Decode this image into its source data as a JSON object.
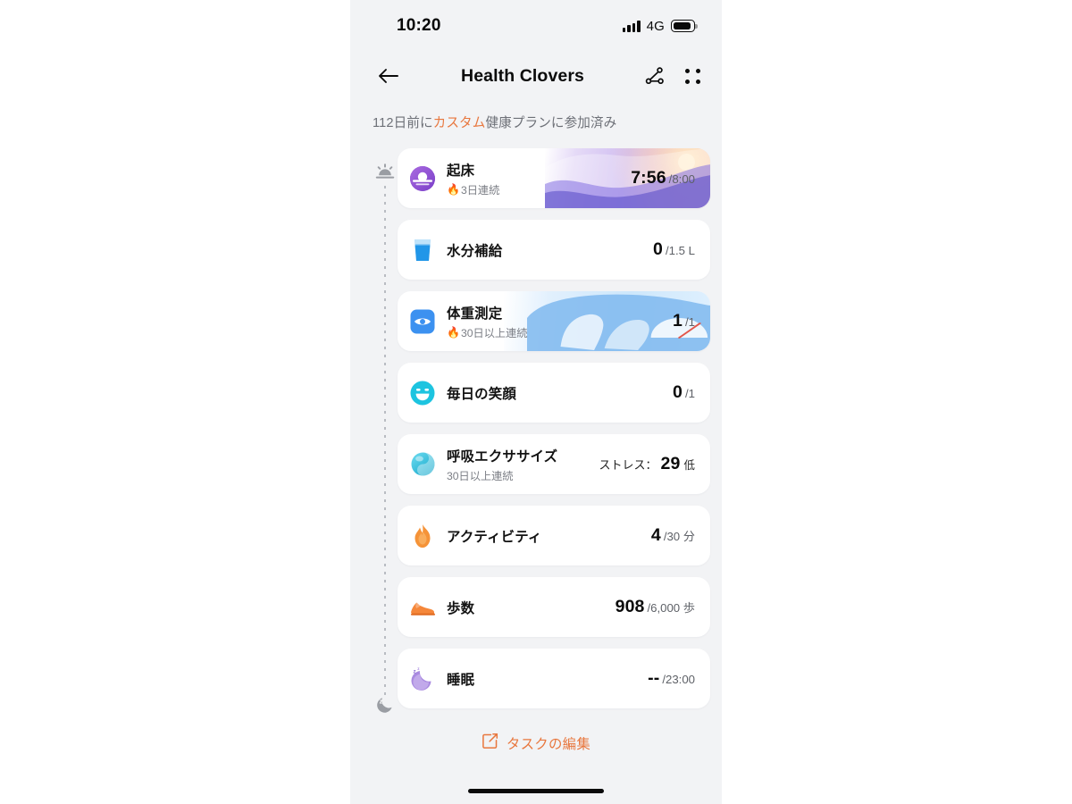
{
  "status_bar": {
    "time": "10:20",
    "network": "4G",
    "signal_icon": "signal-bars-icon",
    "battery_icon": "battery-icon"
  },
  "nav": {
    "back_icon": "back-arrow-icon",
    "title": "Health Clovers",
    "share_icon": "share-node-icon",
    "more_icon": "grid-dots-icon"
  },
  "subtitle": {
    "prefix": "112日前に",
    "highlight": "カスタム",
    "suffix": "健康プランに参加済み",
    "highlight_color": "#e8773e"
  },
  "timeline": {
    "start_icon": "sunrise-icon",
    "end_icon": "moon-sleep-icon"
  },
  "tasks": [
    {
      "id": "wake-up",
      "icon": "sunrise-circle-icon",
      "title": "起床",
      "streak": "3日連続",
      "streak_flame": "🔥",
      "value": "7:56",
      "unit": "/8:00",
      "suffix": "",
      "value_label": "",
      "art": "wake-gradient"
    },
    {
      "id": "hydration",
      "icon": "water-glass-icon",
      "title": "水分補給",
      "streak": "",
      "streak_flame": "",
      "value": "0",
      "unit": "/1.5 L",
      "suffix": "",
      "value_label": "",
      "art": "none"
    },
    {
      "id": "weight",
      "icon": "weight-scale-icon",
      "title": "体重測定",
      "streak": "30日以上連続",
      "streak_flame": "🔥",
      "value": "1",
      "unit": "/1",
      "suffix": "",
      "value_label": "",
      "art": "weight-scale-illustration"
    },
    {
      "id": "smile",
      "icon": "smile-face-icon",
      "title": "毎日の笑顔",
      "streak": "",
      "streak_flame": "",
      "value": "0",
      "unit": "/1",
      "suffix": "",
      "value_label": "",
      "art": "none"
    },
    {
      "id": "breathing",
      "icon": "breathing-sphere-icon",
      "title": "呼吸エクササイズ",
      "streak": "30日以上連続",
      "streak_flame": "",
      "value": "29",
      "unit": "",
      "suffix": "低",
      "value_label": "ストレス：",
      "art": "none"
    },
    {
      "id": "activity",
      "icon": "flame-icon",
      "title": "アクティビティ",
      "streak": "",
      "streak_flame": "",
      "value": "4",
      "unit": "/30 分",
      "suffix": "",
      "value_label": "",
      "art": "none"
    },
    {
      "id": "steps",
      "icon": "running-shoe-icon",
      "title": "歩数",
      "streak": "",
      "streak_flame": "",
      "value": "908",
      "unit": "/6,000 歩",
      "suffix": "",
      "value_label": "",
      "art": "none"
    },
    {
      "id": "sleep",
      "icon": "sleeping-moon-icon",
      "title": "睡眠",
      "streak": "",
      "streak_flame": "",
      "value": "--",
      "unit": "/23:00",
      "suffix": "",
      "value_label": "",
      "art": "none"
    }
  ],
  "edit": {
    "icon": "edit-square-pencil-icon",
    "label": "タスクの編集"
  }
}
